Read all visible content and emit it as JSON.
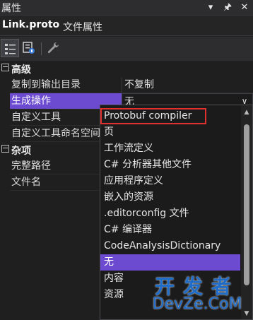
{
  "window": {
    "title": "属性",
    "buttons": [
      "▾",
      "🖈",
      "✕"
    ]
  },
  "object": {
    "name": "Link.proto",
    "type": "文件属性"
  },
  "toolbar": {
    "items": [
      "categorized-view",
      "property-pages",
      "wrench"
    ]
  },
  "categories": [
    {
      "label": "高级",
      "properties": [
        {
          "name": "复制到输出目录",
          "value": "不复制"
        },
        {
          "name": "生成操作",
          "value": "无"
        },
        {
          "name": "自定义工具",
          "value": ""
        },
        {
          "name": "自定义工具命名空间",
          "value": ""
        }
      ]
    },
    {
      "label": "杂项",
      "properties": [
        {
          "name": "完整路径",
          "value": ""
        },
        {
          "name": "文件名",
          "value": ""
        }
      ]
    }
  ],
  "dropdown": {
    "items": [
      "Protobuf compiler",
      "页",
      "工作流定义",
      "C# 分析器其他文件",
      "应用程序定义",
      "嵌入的资源",
      ".editorconfig 文件",
      "C# 编译器",
      "CodeAnalysisDictionary",
      "无",
      "内容",
      "资源"
    ],
    "selected": "无",
    "highlighted": "Protobuf compiler"
  },
  "watermark": {
    "line1": "开发者",
    "line2": "DevZe.CoM"
  },
  "colors": {
    "accent": "#6c4bd1",
    "highlight_box": "#e03030",
    "watermark": "#1f6cc9"
  }
}
